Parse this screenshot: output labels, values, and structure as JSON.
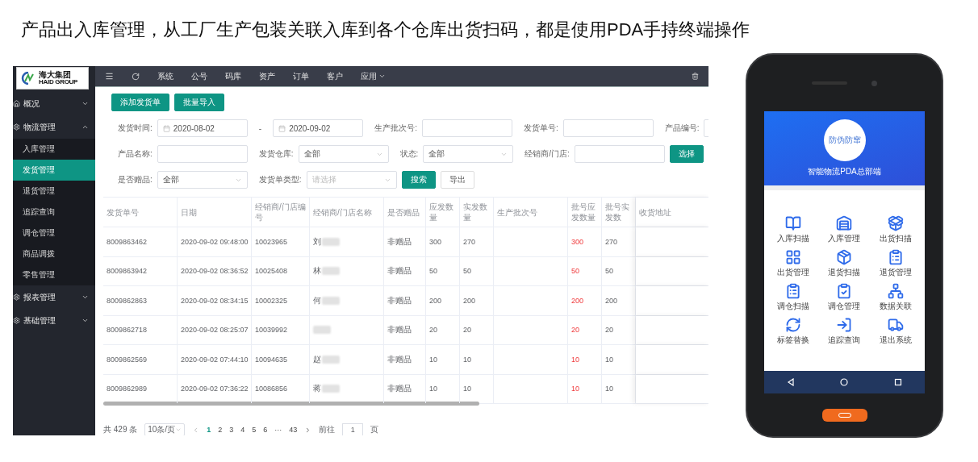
{
  "heading": "产品出入库管理，从工厂生产包装关联入库到各个仓库出货扫码，都是使用PDA手持终端操作",
  "app": {
    "logo": {
      "name": "海大集团",
      "subtitle": "HAID GROUP"
    },
    "sidebar": [
      {
        "label": "概况",
        "expanded": false
      },
      {
        "label": "物流管理",
        "expanded": true,
        "children": [
          {
            "label": "入库管理",
            "selected": false
          },
          {
            "label": "发货管理",
            "selected": true
          },
          {
            "label": "退货管理",
            "selected": false
          },
          {
            "label": "追踪查询",
            "selected": false
          },
          {
            "label": "调仓管理",
            "selected": false
          },
          {
            "label": "商品调拨",
            "selected": false
          },
          {
            "label": "零售管理",
            "selected": false
          }
        ]
      },
      {
        "label": "报表管理",
        "expanded": false
      },
      {
        "label": "基础管理",
        "expanded": false
      }
    ],
    "topnav": [
      {
        "label": "系统",
        "dropdown": false
      },
      {
        "label": "公号",
        "dropdown": false
      },
      {
        "label": "码库",
        "dropdown": false
      },
      {
        "label": "资产",
        "dropdown": false
      },
      {
        "label": "订单",
        "dropdown": false
      },
      {
        "label": "客户",
        "dropdown": false
      },
      {
        "label": "应用",
        "dropdown": true
      }
    ],
    "actions": [
      "添加发货单",
      "批量导入"
    ],
    "filters": [
      [
        {
          "kind": "date",
          "label": "发货时间:",
          "value": "2020-08-02"
        },
        {
          "kind": "dash",
          "text": "-"
        },
        {
          "kind": "date",
          "value": "2020-09-02"
        },
        {
          "kind": "text",
          "label": "生产批次号:"
        },
        {
          "kind": "text",
          "label": "发货单号:"
        },
        {
          "kind": "text",
          "label": "产品编号:"
        }
      ],
      [
        {
          "kind": "text",
          "label": "产品名称:"
        },
        {
          "kind": "select",
          "label": "发货仓库:",
          "value": "全部"
        },
        {
          "kind": "select",
          "label": "状态:",
          "value": "全部"
        },
        {
          "kind": "text",
          "label": "经销商/门店:"
        },
        {
          "kind": "button",
          "text": "选择",
          "primary": true
        }
      ],
      [
        {
          "kind": "select",
          "label": "是否赠品:",
          "value": "全部"
        },
        {
          "kind": "select",
          "label": "发货单类型:",
          "placeholder": "请选择"
        },
        {
          "kind": "button",
          "text": "搜索",
          "primary": true
        },
        {
          "kind": "button",
          "text": "导出",
          "primary": false
        }
      ]
    ],
    "table": {
      "columns": [
        "发货单号",
        "日期",
        "经销商/门店编号",
        "经销商/门店名称",
        "是否赠品",
        "应发数量",
        "实发数量",
        "生产批次号",
        "批号应发数量",
        "批号实发数",
        "收货地址"
      ],
      "rows": [
        {
          "order": "8009863462",
          "date": "2020-09-02 09:48:00",
          "dealer_code": "10023965",
          "dealer_name": "刘",
          "gift": "非赠品",
          "qty_due": "300",
          "qty_sent": "270",
          "batch_due": "300",
          "batch_sent": "270"
        },
        {
          "order": "8009863942",
          "date": "2020-09-02 08:36:52",
          "dealer_code": "10025408",
          "dealer_name": "林",
          "gift": "非赠品",
          "qty_due": "50",
          "qty_sent": "50",
          "batch_due": "50",
          "batch_sent": "50"
        },
        {
          "order": "8009862863",
          "date": "2020-09-02 08:34:15",
          "dealer_code": "10002325",
          "dealer_name": "何",
          "gift": "非赠品",
          "qty_due": "200",
          "qty_sent": "200",
          "batch_due": "200",
          "batch_sent": "200"
        },
        {
          "order": "8009862718",
          "date": "2020-09-02 08:25:07",
          "dealer_code": "10039992",
          "gift": "非赠品",
          "qty_due": "20",
          "qty_sent": "20",
          "batch_due": "20",
          "batch_sent": "20"
        },
        {
          "order": "8009862569",
          "date": "2020-09-02 07:44:10",
          "dealer_code": "10094635",
          "dealer_name": "赵",
          "gift": "非赠品",
          "qty_due": "10",
          "qty_sent": "10",
          "batch_due": "10",
          "batch_sent": "10"
        },
        {
          "order": "8009862989",
          "date": "2020-09-02 07:36:22",
          "dealer_code": "10086856",
          "dealer_name": "蒋",
          "gift": "非赠品",
          "qty_due": "10",
          "qty_sent": "10",
          "batch_due": "10",
          "batch_sent": "10"
        }
      ]
    },
    "pagination": {
      "total": "共 429 条",
      "page_size": "10条/页",
      "pages": [
        {
          "label": "1",
          "selected": true
        },
        {
          "label": "2",
          "selected": false
        },
        {
          "label": "3",
          "selected": false
        },
        {
          "label": "4",
          "selected": false
        },
        {
          "label": "5",
          "selected": false
        },
        {
          "label": "6",
          "selected": false
        },
        {
          "label": "···",
          "selected": false
        },
        {
          "label": "43",
          "selected": false
        }
      ],
      "goto_label": "前往",
      "goto_value": "1",
      "goto_suffix": "页"
    }
  },
  "phone": {
    "logo_text": "防伪防窜",
    "title": "智能物流PDA总部端",
    "apps": [
      {
        "label": "入库扫描"
      },
      {
        "label": "入库管理"
      },
      {
        "label": "出货扫描"
      },
      {
        "label": "出货管理"
      },
      {
        "label": "退货扫描"
      },
      {
        "label": "退货管理"
      },
      {
        "label": "调仓扫描"
      },
      {
        "label": "调仓管理"
      },
      {
        "label": "数据关联"
      },
      {
        "label": "标签替换"
      },
      {
        "label": "追踪查询"
      },
      {
        "label": "退出系统"
      }
    ]
  }
}
